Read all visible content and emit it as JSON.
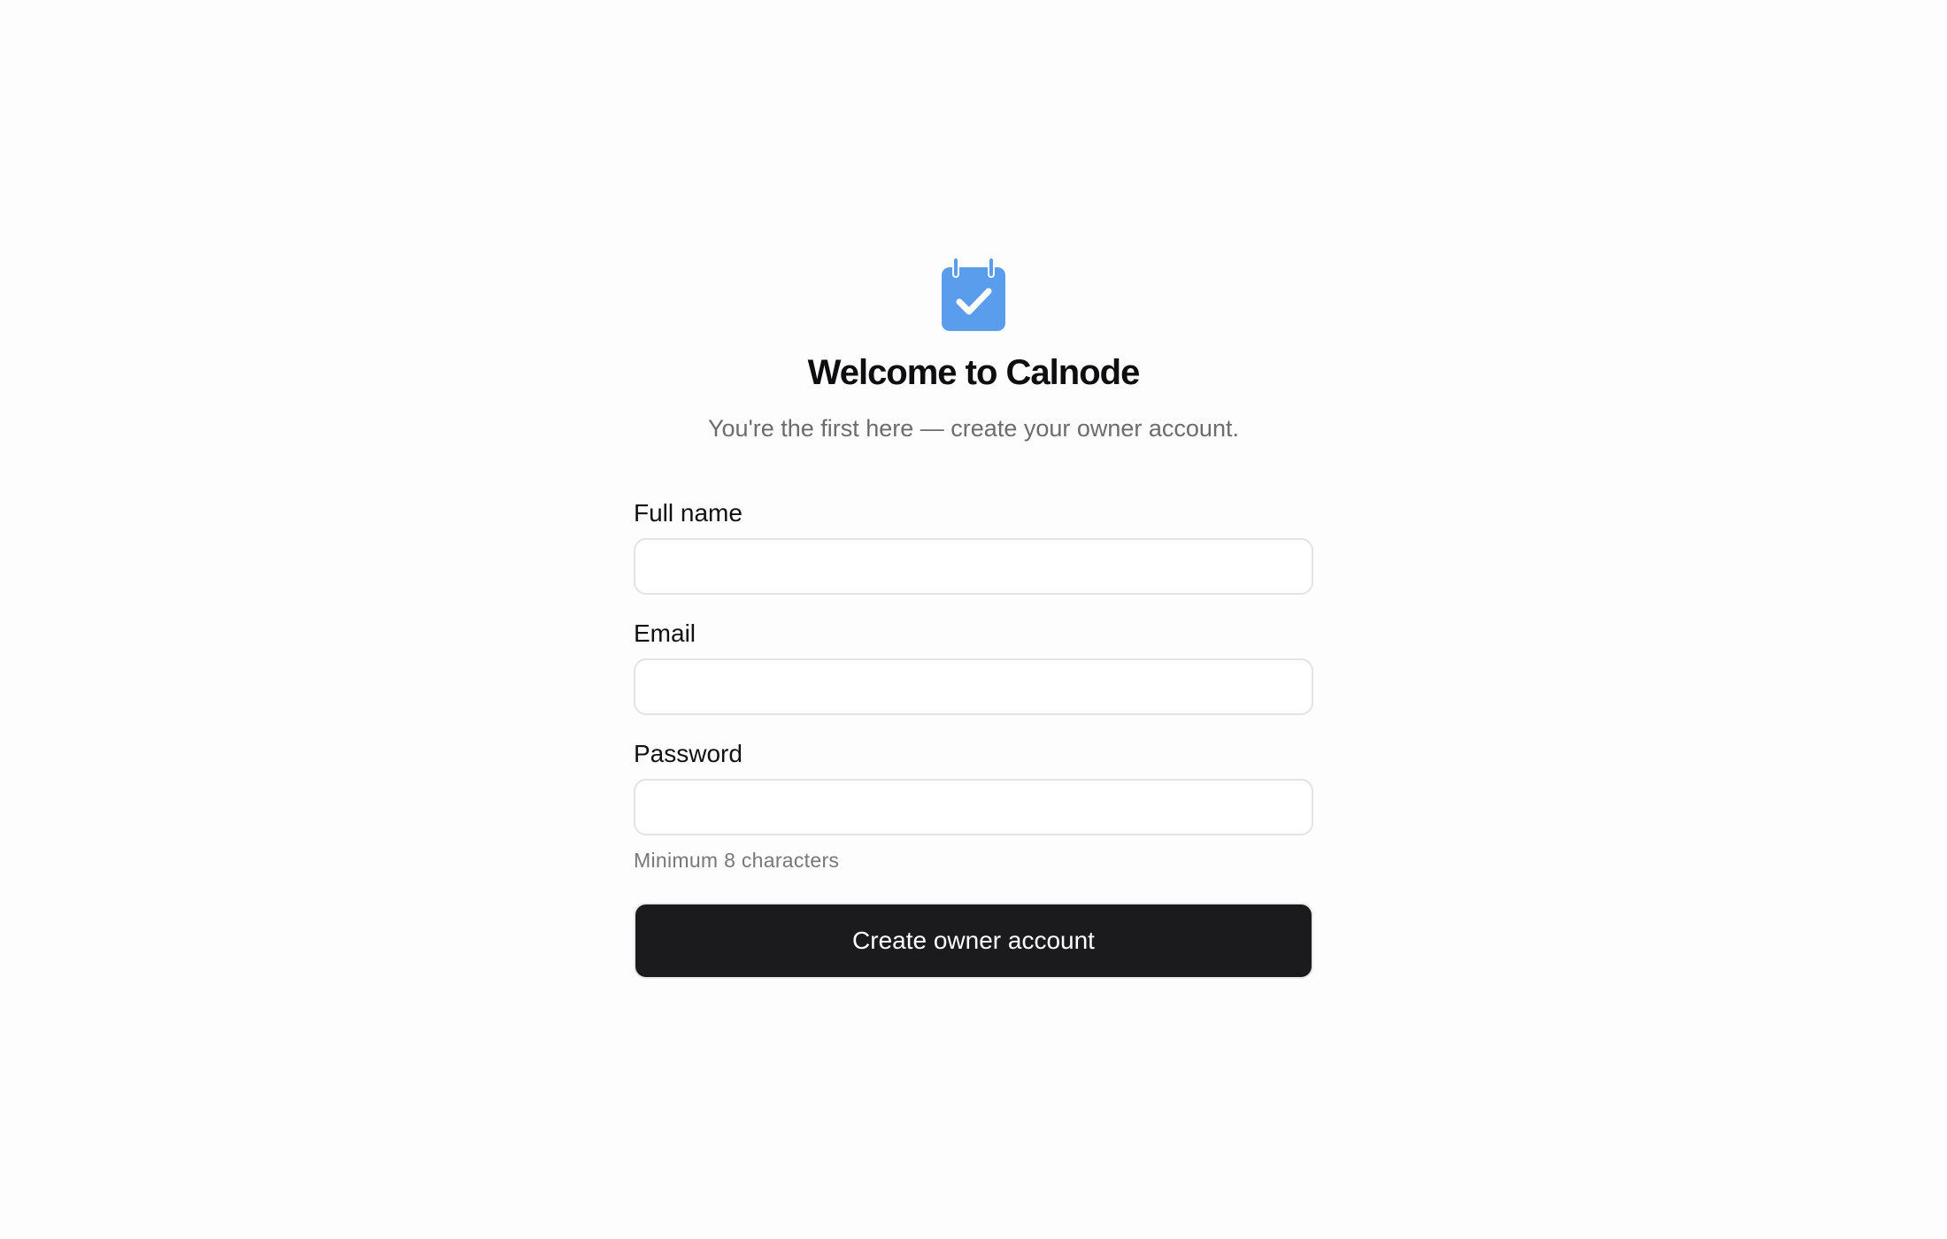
{
  "app": {
    "logo_icon": "calendar-check-icon",
    "accent_color": "#5b9ded"
  },
  "header": {
    "title": "Welcome to Calnode",
    "subtitle": "You're the first here — create your owner account."
  },
  "form": {
    "full_name": {
      "label": "Full name",
      "value": "",
      "placeholder": ""
    },
    "email": {
      "label": "Email",
      "value": "",
      "placeholder": ""
    },
    "password": {
      "label": "Password",
      "value": "",
      "placeholder": "",
      "hint": "Minimum 8 characters"
    },
    "submit_label": "Create owner account"
  }
}
